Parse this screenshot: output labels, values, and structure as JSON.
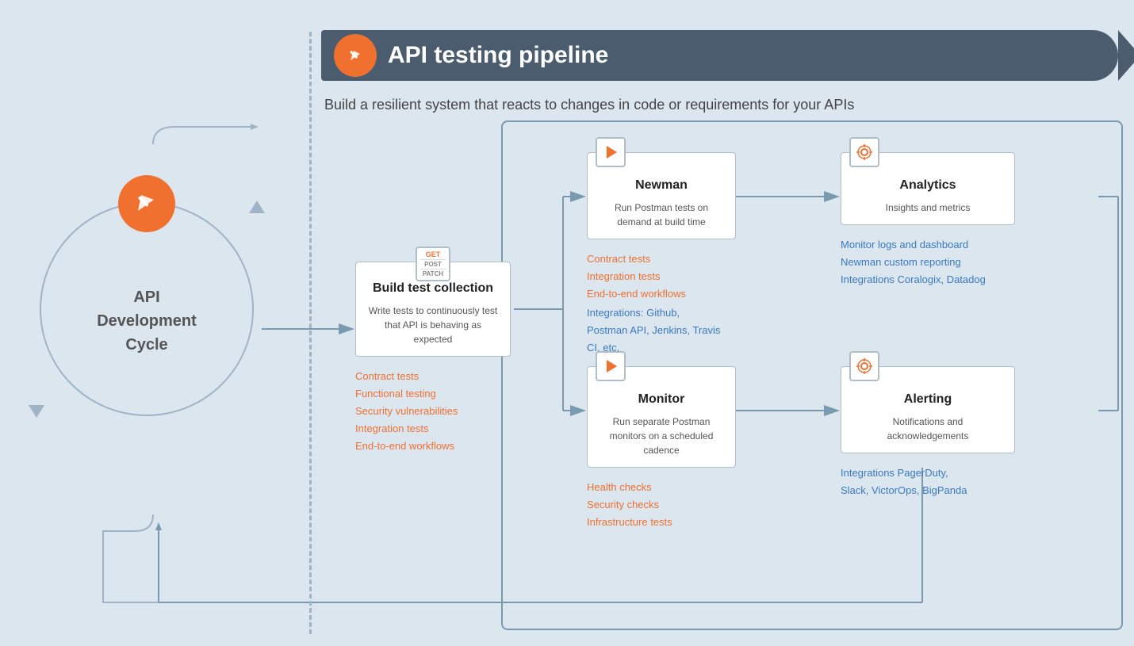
{
  "pipeline": {
    "title": "API testing pipeline",
    "subtitle": "Build a resilient system that reacts to changes in code or requirements for your APIs"
  },
  "cycle": {
    "title": "API\nDevelopment\nCycle"
  },
  "build_test": {
    "title": "Build test collection",
    "desc": "Write tests to continuously test that API is behaving as expected",
    "orange_items": [
      "Contract tests",
      "Functional testing",
      "Security vulnerabilities",
      "Integration tests",
      "End-to-end workflows"
    ]
  },
  "newman": {
    "title": "Newman",
    "desc": "Run Postman tests on demand at build time",
    "orange_items": [
      "Contract tests",
      "Integration tests",
      "End-to-end workflows"
    ],
    "blue_items": [
      "Integrations: Github,",
      "Postman API, Jenkins, Travis CI, etc."
    ]
  },
  "monitor": {
    "title": "Monitor",
    "desc": "Run separate Postman monitors on a scheduled cadence",
    "orange_items": [
      "Health checks",
      "Security checks",
      "Infrastructure tests"
    ]
  },
  "analytics": {
    "title": "Analytics",
    "desc": "Insights and metrics",
    "blue_items": [
      "Monitor logs and dashboard",
      "Newman custom reporting",
      "Integrations Coralogix, Datadog"
    ]
  },
  "alerting": {
    "title": "Alerting",
    "desc": "Notifications and acknowledgements",
    "blue_items": [
      "Integrations PagerDuty,",
      "Slack, VictorOps, BigPanda"
    ]
  },
  "colors": {
    "orange": "#f07030",
    "blue": "#3a7abf",
    "dark": "#4a5c6e",
    "text_dark": "#222",
    "text_mid": "#555",
    "border": "#b0bec8"
  }
}
